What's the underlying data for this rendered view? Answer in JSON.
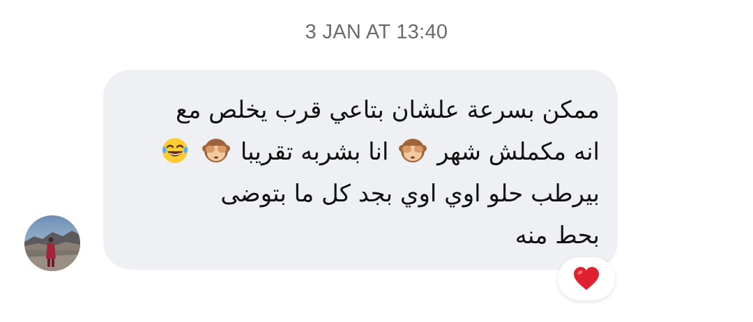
{
  "conversation": {
    "timestamp": "3 JAN AT 13:40"
  },
  "message": {
    "sender_avatar": "profile-photo",
    "line1": "ممكن بسرعة علشان بتاعي قرب يخلص مع",
    "line2_text_a": "انه مكملش شهر",
    "line2_text_b": "انا بشربه تقريبا",
    "line3": "بيرطب حلو اوي اوي بجد كل ما بتوضى",
    "line4": "بحط منه",
    "emojis": [
      "see-no-evil-monkey",
      "see-no-evil-monkey",
      "face-with-tears-of-joy"
    ]
  },
  "reaction": {
    "emoji": "red-heart",
    "color": "#e0212f"
  },
  "colors": {
    "bubble_background": "#eff0f4",
    "timestamp_text": "#6b6b6b",
    "message_text": "#111111"
  }
}
